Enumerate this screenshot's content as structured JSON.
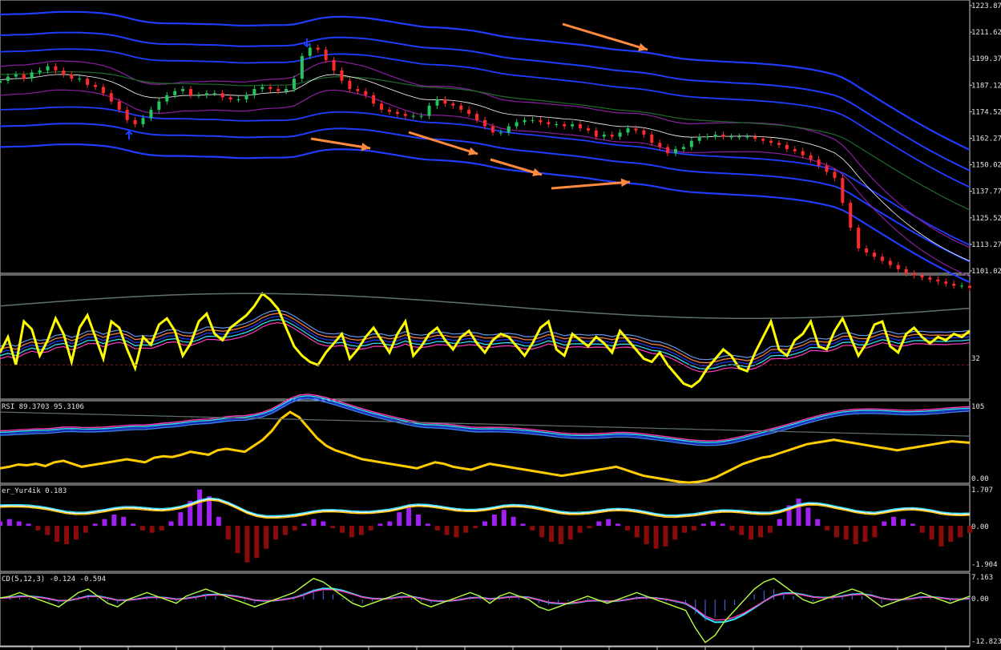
{
  "theme": {
    "background": "#000000",
    "frame": "#c8c8c8",
    "axis_text": "#e6e6e6",
    "bull": "#22c55e",
    "bear": "#ff2a2a",
    "blue_bands": "#1f3cff",
    "purple": "#8b1ea0",
    "green_dark": "#1f6b2a",
    "yellow": "#ffff00",
    "orange": "#ff8a3d",
    "gray_line": "#607070",
    "cyan": "#33e6ff",
    "pink": "#ff3bbf",
    "gold": "#ffcc00",
    "maroon": "#8b0b0b",
    "violet": "#a020f0",
    "lime": "#b5ff40"
  },
  "chart_data": [
    {
      "type": "line",
      "name": "price",
      "x": "index",
      "ylim": [
        1096,
        1228
      ],
      "yticks": [
        "1223.87",
        "1211.62",
        "1199.37",
        "1187.12",
        "1174.52",
        "1162.27",
        "1150.02",
        "1137.77",
        "1125.52",
        "1113.27",
        "1101.02"
      ],
      "close": [
        1189,
        1191,
        1192,
        1190,
        1193,
        1194,
        1196,
        1194,
        1192,
        1190,
        1190,
        1187,
        1186,
        1183,
        1179,
        1175,
        1170,
        1168,
        1171,
        1175,
        1179,
        1182,
        1184,
        1185,
        1182,
        1182,
        1183,
        1183,
        1181,
        1180,
        1180,
        1182,
        1185,
        1186,
        1185,
        1184,
        1185,
        1190,
        1201,
        1205,
        1204,
        1199,
        1194,
        1189,
        1185,
        1184,
        1182,
        1178,
        1175,
        1174,
        1173,
        1172,
        1172,
        1172,
        1177,
        1180,
        1178,
        1177,
        1175,
        1173,
        1170,
        1167,
        1164,
        1164,
        1167,
        1169,
        1170,
        1170,
        1169,
        1168,
        1168,
        1167,
        1168,
        1166,
        1165,
        1162,
        1163,
        1162,
        1164,
        1166,
        1165,
        1163,
        1159,
        1157,
        1154,
        1156,
        1157,
        1160,
        1162,
        1162,
        1163,
        1162,
        1162,
        1162,
        1162,
        1161,
        1160,
        1159,
        1158,
        1156,
        1155,
        1153,
        1151,
        1148,
        1145,
        1142,
        1130,
        1118,
        1108,
        1106,
        1104,
        1102,
        1100,
        1098,
        1096,
        1095,
        1094,
        1093,
        1092,
        1091,
        1090,
        1090,
        1089
      ],
      "arrows": [
        "down-right",
        "right",
        "down-right",
        "down-right",
        "right"
      ],
      "signals": [
        "up",
        "down"
      ]
    },
    {
      "type": "line",
      "name": "indicator",
      "ytick": "32",
      "yellow": [
        50,
        60,
        42,
        70,
        65,
        48,
        58,
        72,
        62,
        44,
        66,
        74,
        60,
        46,
        70,
        66,
        52,
        40,
        60,
        55,
        68,
        72,
        64,
        48,
        56,
        70,
        75,
        62,
        58,
        66,
        70,
        74,
        80,
        88,
        84,
        78,
        66,
        54,
        48,
        44,
        42,
        50,
        56,
        62,
        46,
        52,
        60,
        66,
        58,
        50,
        62,
        70,
        48,
        54,
        62,
        66,
        58,
        52,
        60,
        64,
        56,
        50,
        58,
        62,
        60,
        54,
        48,
        56,
        66,
        70,
        52,
        48,
        62,
        58,
        54,
        60,
        56,
        50,
        64,
        58,
        52,
        46,
        44,
        50,
        42,
        36,
        30,
        28,
        32,
        40,
        46,
        52,
        48,
        40,
        38,
        50,
        60,
        70,
        52,
        48,
        58,
        62,
        70,
        54,
        52,
        64,
        72,
        60,
        48,
        56,
        68,
        70,
        54,
        50,
        62,
        66,
        60,
        56,
        60,
        58,
        62,
        60,
        64
      ]
    },
    {
      "type": "line",
      "name": "RSI",
      "ylim": [
        0,
        110
      ],
      "yticks": [
        "105",
        "0.00"
      ],
      "yellow": [
        20,
        22,
        25,
        24,
        26,
        23,
        28,
        30,
        26,
        22,
        24,
        26,
        28,
        30,
        32,
        30,
        28,
        34,
        36,
        35,
        38,
        42,
        40,
        38,
        44,
        46,
        44,
        42,
        50,
        58,
        70,
        86,
        95,
        88,
        74,
        60,
        50,
        44,
        40,
        36,
        32,
        30,
        28,
        26,
        24,
        22,
        20,
        24,
        28,
        26,
        22,
        20,
        18,
        22,
        26,
        24,
        22,
        20,
        18,
        16,
        14,
        12,
        10,
        12,
        14,
        16,
        18,
        20,
        22,
        18,
        14,
        10,
        8,
        6,
        4,
        2,
        1,
        2,
        4,
        8,
        14,
        20,
        26,
        30,
        34,
        36,
        40,
        44,
        48,
        52,
        54,
        56,
        58,
        56,
        54,
        52,
        50,
        48,
        46,
        44,
        46,
        48,
        50,
        52,
        54,
        56,
        55,
        54
      ]
    },
    {
      "type": "bar",
      "name": "histogram",
      "yticks": [
        "1.707",
        "0.00",
        "-1.904"
      ],
      "values": [
        0.2,
        0.3,
        0.2,
        0.1,
        -0.2,
        -0.4,
        -0.7,
        -0.8,
        -0.6,
        -0.3,
        0.1,
        0.3,
        0.5,
        0.4,
        0.1,
        -0.2,
        -0.3,
        -0.2,
        0.2,
        0.6,
        1.1,
        1.6,
        1.3,
        0.4,
        -0.6,
        -1.2,
        -1.6,
        -1.4,
        -1.0,
        -0.6,
        -0.4,
        -0.2,
        0.1,
        0.3,
        0.2,
        -0.1,
        -0.3,
        -0.5,
        -0.4,
        -0.2,
        0.1,
        0.2,
        0.6,
        0.9,
        0.5,
        0.1,
        -0.2,
        -0.4,
        -0.5,
        -0.3,
        -0.1,
        0.2,
        0.5,
        0.7,
        0.4,
        0.1,
        -0.2,
        -0.5,
        -0.7,
        -0.8,
        -0.6,
        -0.3,
        -0.1,
        0.2,
        0.3,
        0.1,
        -0.2,
        -0.5,
        -0.8,
        -1.0,
        -0.9,
        -0.6,
        -0.3,
        -0.2,
        0.1,
        0.2,
        0.1,
        -0.2,
        -0.4,
        -0.6,
        -0.5,
        -0.3,
        0.3,
        0.9,
        1.2,
        0.8,
        0.3,
        -0.2,
        -0.5,
        -0.6,
        -0.8,
        -0.7,
        -0.5,
        0.2,
        0.4,
        0.3,
        0.1,
        -0.3,
        -0.6,
        -0.9,
        -0.7,
        -0.5,
        -0.3
      ],
      "label": "er_Yur4ik 0.183"
    },
    {
      "type": "line",
      "name": "MACD",
      "ylim": [
        -13,
        7.5
      ],
      "yticks": [
        "7.163",
        "0.00",
        "-12.823"
      ],
      "label": "CD(5,12,3) -0.124 -0.594",
      "lime": [
        0.5,
        1,
        2,
        1,
        0,
        -1,
        -2,
        0,
        2,
        3,
        1,
        -1,
        -2,
        0,
        1,
        2,
        1,
        0,
        -1,
        1,
        2,
        3,
        2,
        1,
        0,
        -1,
        -2,
        -1,
        0,
        1,
        2,
        4,
        6,
        5,
        3,
        1,
        -1,
        -2,
        -1,
        0,
        1,
        2,
        1,
        -1,
        -2,
        -1,
        0,
        1,
        2,
        1,
        -1,
        1,
        2,
        1,
        0,
        -2,
        -3,
        -2,
        -1,
        0,
        1,
        0,
        -1,
        0,
        1,
        2,
        1,
        0,
        -1,
        -2,
        -3,
        -8,
        -12,
        -10,
        -6,
        -3,
        0,
        3,
        5,
        6,
        4,
        2,
        0,
        -1,
        0,
        1,
        2,
        3,
        2,
        0,
        -2,
        -1,
        0,
        1,
        2,
        1,
        0,
        -1,
        0,
        1
      ]
    }
  ],
  "labels": {
    "rsi_title": "RSI 89.3703 95.3106"
  },
  "time_axis_hint": "time axis labels (partially visible)"
}
